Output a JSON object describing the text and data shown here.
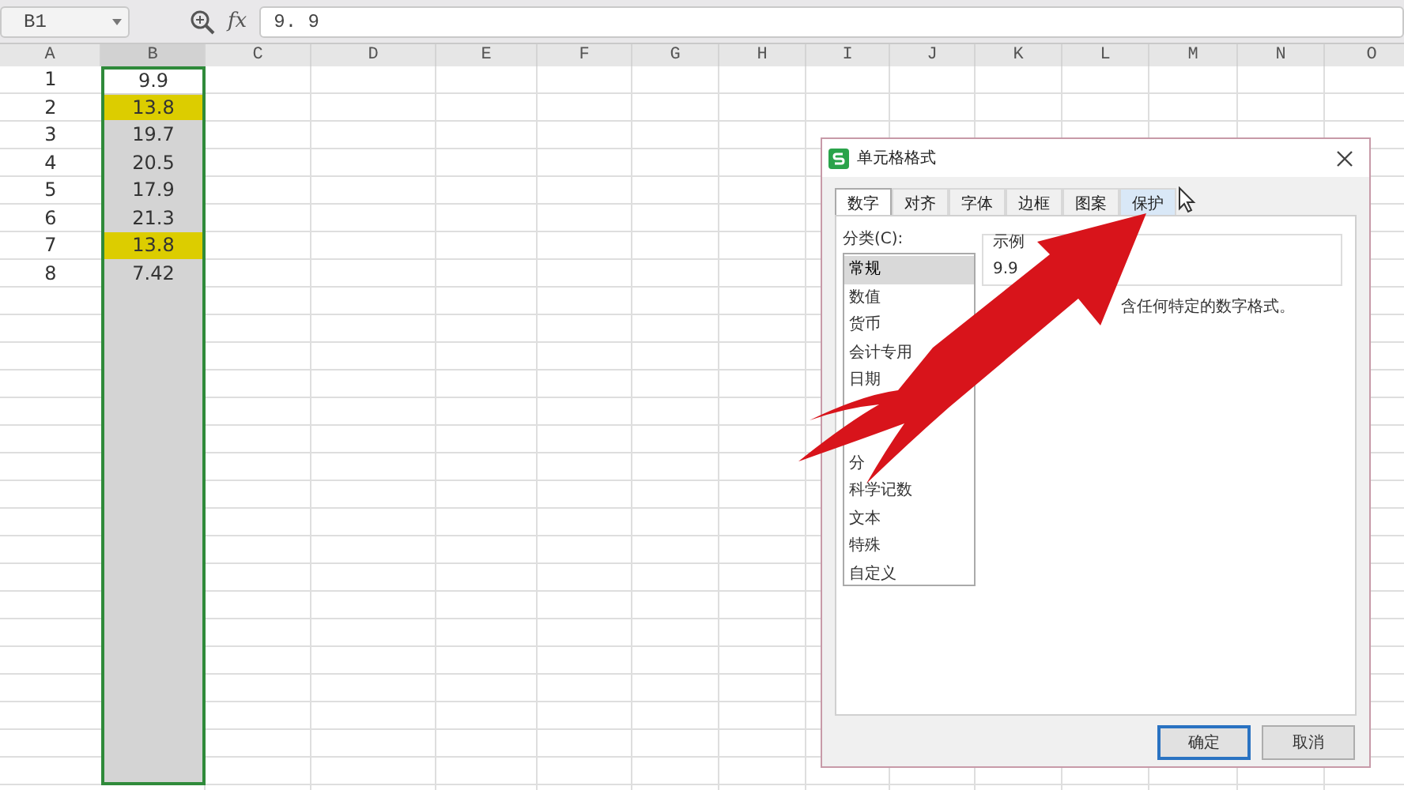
{
  "formula_bar": {
    "name_box": "B1",
    "formula_label": "fx",
    "value": "9. 9"
  },
  "sheet": {
    "columns": [
      {
        "label": "A",
        "selected": false
      },
      {
        "label": "B",
        "selected": true
      },
      {
        "label": "C",
        "selected": false
      },
      {
        "label": "D",
        "selected": false
      },
      {
        "label": "E",
        "selected": false
      },
      {
        "label": "F",
        "selected": false
      },
      {
        "label": "G",
        "selected": false
      },
      {
        "label": "H",
        "selected": false
      },
      {
        "label": "I",
        "selected": false
      },
      {
        "label": "J",
        "selected": false
      },
      {
        "label": "K",
        "selected": false
      },
      {
        "label": "L",
        "selected": false
      },
      {
        "label": "M",
        "selected": false
      },
      {
        "label": "N",
        "selected": false
      },
      {
        "label": "O",
        "selected": false
      }
    ],
    "rows": [
      {
        "number": "1",
        "value": "9.9",
        "highlight": false,
        "active": true
      },
      {
        "number": "2",
        "value": "13.8",
        "highlight": true,
        "active": false
      },
      {
        "number": "3",
        "value": "19.7",
        "highlight": false,
        "active": false
      },
      {
        "number": "4",
        "value": "20.5",
        "highlight": false,
        "active": false
      },
      {
        "number": "5",
        "value": "17.9",
        "highlight": false,
        "active": false
      },
      {
        "number": "6",
        "value": "21.3",
        "highlight": false,
        "active": false
      },
      {
        "number": "7",
        "value": "13.8",
        "highlight": true,
        "active": false
      },
      {
        "number": "8",
        "value": "7.42",
        "highlight": false,
        "active": false
      }
    ]
  },
  "dialog": {
    "title": "单元格格式",
    "tabs": [
      {
        "label": "数字",
        "selected": true
      },
      {
        "label": "对齐",
        "selected": false
      },
      {
        "label": "字体",
        "selected": false
      },
      {
        "label": "边框",
        "selected": false
      },
      {
        "label": "图案",
        "selected": false
      },
      {
        "label": "保护",
        "selected": false,
        "hovered": true
      }
    ],
    "category_label": "分类(C):",
    "categories": [
      {
        "label": "常规",
        "selected": true
      },
      {
        "label": "数值",
        "selected": false
      },
      {
        "label": "货币",
        "selected": false
      },
      {
        "label": "会计专用",
        "selected": false
      },
      {
        "label": "日期",
        "selected": false
      }
    ],
    "categories_lower": [
      {
        "label": "分",
        "selected": false
      },
      {
        "label": "科学记数",
        "selected": false
      },
      {
        "label": "文本",
        "selected": false
      },
      {
        "label": "特殊",
        "selected": false
      },
      {
        "label": "自定义",
        "selected": false
      }
    ],
    "sample_label": "示例",
    "sample_value": "9.9",
    "description": "含任何特定的数字格式。",
    "buttons": [
      {
        "label": "确定",
        "default": true
      },
      {
        "label": "取消",
        "default": false
      }
    ]
  }
}
